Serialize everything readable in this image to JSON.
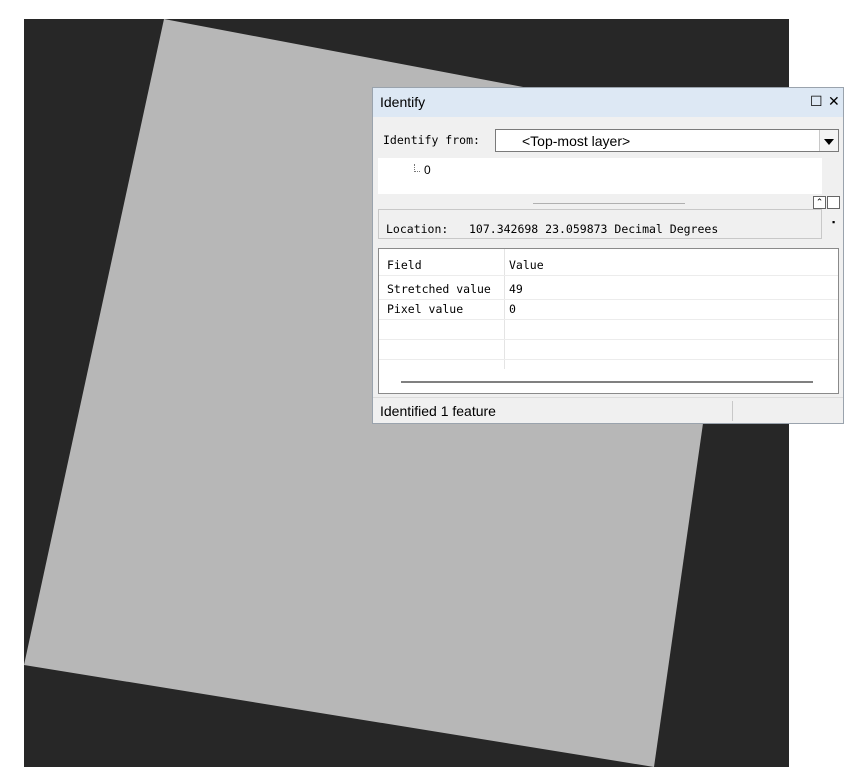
{
  "window": {
    "title": "Identify",
    "maximize_icon": "maximize-icon",
    "close_icon": "close-icon"
  },
  "identify_from": {
    "label": "Identify from:",
    "value": "<Top-most layer>"
  },
  "tree": {
    "items": [
      {
        "label": "0"
      }
    ]
  },
  "location": {
    "label": "Location:",
    "value": "107.342698  23.059873 Decimal Degrees"
  },
  "table": {
    "headers": [
      "Field",
      "Value"
    ],
    "rows": [
      [
        "Stretched value",
        "49"
      ],
      [
        "Pixel value",
        "0"
      ]
    ]
  },
  "status": {
    "text": "Identified 1 feature"
  },
  "colors": {
    "map_background": "#272727",
    "raster_fill": "#b7b7b7",
    "title_bar": "#dde8f4"
  }
}
